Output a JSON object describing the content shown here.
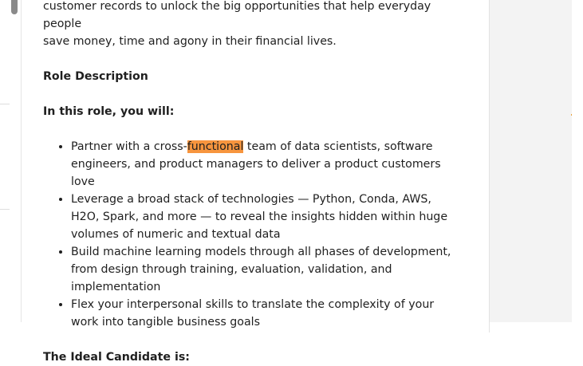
{
  "document": {
    "intro_line1": "customer records to unlock the big opportunities that help everyday people",
    "intro_line2": "save money, time and agony in their financial lives.",
    "role_description_heading": "Role Description",
    "in_this_role_heading": "In this role, you will:",
    "bullets": [
      {
        "before": "Partner with a cross-",
        "highlight": "functional",
        "after": " team of data scientists, software engineers, and product managers to deliver a product customers love"
      },
      {
        "text": "Leverage a broad stack of technologies — Python, Conda, AWS, H2O, Spark, and more — to reveal the insights hidden within huge volumes of numeric and textual data"
      },
      {
        "text": "Build machine learning models through all phases of development, from design through training, evaluation, validation, and implementation"
      },
      {
        "text": "Flex your interpersonal skills to translate the complexity of your work into tangible business goals"
      }
    ],
    "ideal_candidate_heading": "The Ideal Candidate is:"
  },
  "colors": {
    "search_highlight": "#f7953e",
    "right_pane_bg": "#f3f3f3",
    "marker": "#e8a13a"
  }
}
